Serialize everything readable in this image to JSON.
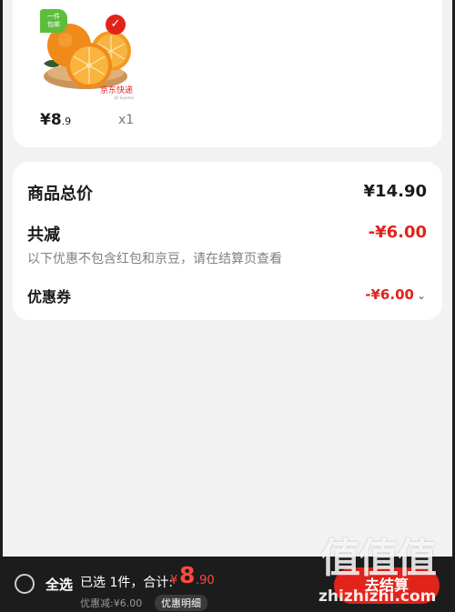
{
  "product": {
    "badge_text": "一件\n包邮",
    "courier_logo": "京东快递",
    "courier_sub": "JD Express",
    "price_symbol": "¥",
    "price_int": "8",
    "price_cents": ".9",
    "quantity": "x1"
  },
  "summary": {
    "total_label": "商品总价",
    "total_value": "¥14.90",
    "reduce_label": "共减",
    "reduce_value": "-¥6.00",
    "note": "以下优惠不包含红包和京豆，请在结算页查看",
    "coupon_label": "优惠券",
    "coupon_value": "-¥6.00",
    "accent_color": "#e2231a"
  },
  "bottom_bar": {
    "select_all": "全选",
    "selected_summary": "已选 1件，合计:",
    "total_symbol": "¥",
    "total_int": "8",
    "total_cents": ".90",
    "discount_line": "优惠减:¥6.00",
    "discount_detail": "优惠明细",
    "checkout": "去结算"
  },
  "watermark": {
    "logo": "值值值",
    "url": "zhizhizhi.com"
  }
}
